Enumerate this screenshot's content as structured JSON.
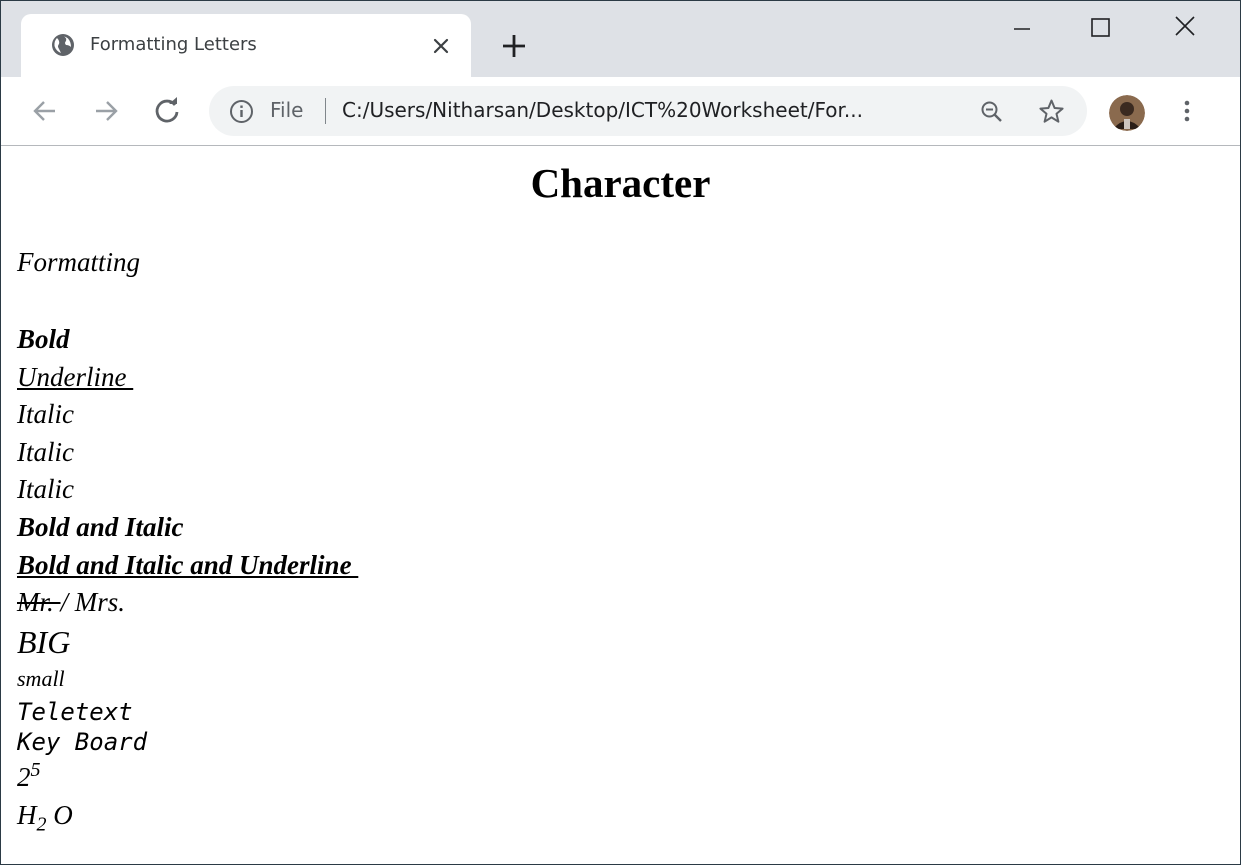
{
  "browser": {
    "tab": {
      "title": "Formatting Letters",
      "favicon": "globe-icon"
    },
    "window_controls": [
      "minimize-icon",
      "maximize-icon",
      "close-icon"
    ],
    "toolbar": {
      "back_icon": "arrow-left-icon",
      "forward_icon": "arrow-right-icon",
      "reload_icon": "reload-icon",
      "scheme_label": "File",
      "url": "C:/Users/Nitharsan/Desktop/ICT%20Worksheet/For...",
      "zoom_icon": "zoom-out-icon",
      "bookmark_icon": "star-icon",
      "menu_icon": "kebab-menu-icon"
    }
  },
  "page": {
    "heading": "Character",
    "formatting": "Formatting",
    "bold": "Bold",
    "underline": "Underline ",
    "italic_1": "Italic",
    "italic_2": "Italic",
    "italic_3": "Italic",
    "bold_italic": "Bold and Italic",
    "bold_italic_underline": "Bold and Italic and Underline ",
    "strike_mr": "Mr. ",
    "slash_mrs": "/ Mrs.",
    "big": "BIG",
    "small": "small",
    "teletext": "Teletext",
    "keyboard": "Key Board",
    "power_base": "2",
    "power_exp": "5",
    "formula_h": "H",
    "formula_sub": "2",
    "formula_o": " O"
  },
  "colors": {
    "tabstrip_bg": "#dee1e6",
    "omnibox_bg": "#f1f3f4",
    "text": "#000000"
  }
}
